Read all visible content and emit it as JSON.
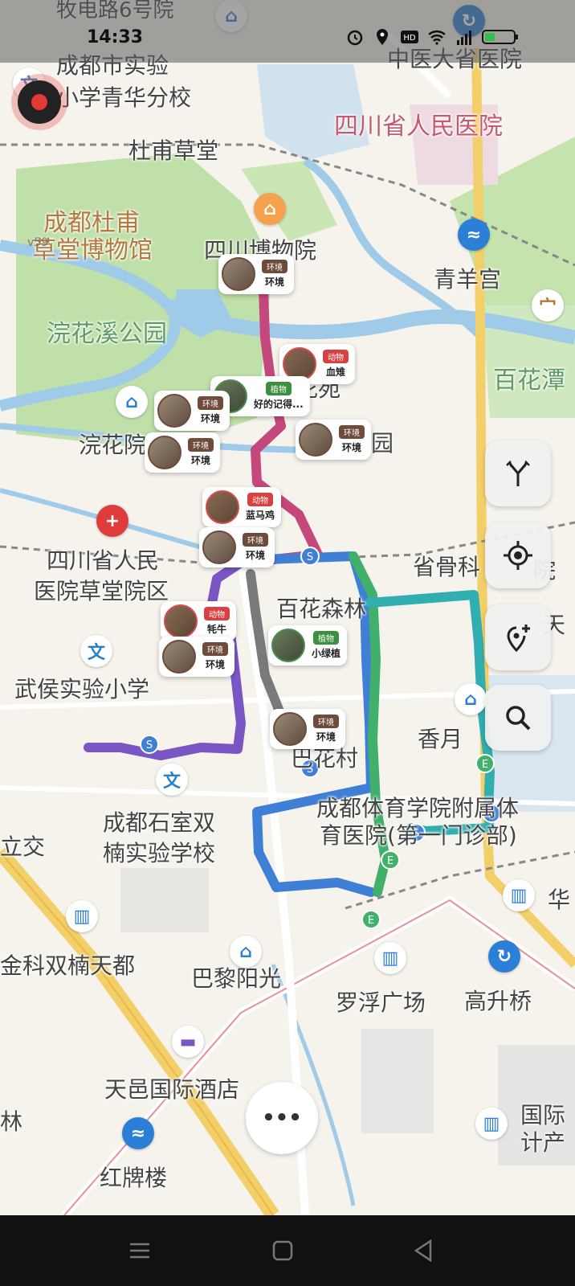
{
  "status_bar": {
    "time": "14:33"
  },
  "map": {
    "version": "v59",
    "labels": [
      {
        "text": "牧电路6号院",
        "class": "med"
      },
      {
        "text": "成都市实验",
        "class": "big"
      },
      {
        "text": "小学青华分校",
        "class": "big"
      },
      {
        "text": "中医大省医院",
        "class": "big"
      },
      {
        "text": "四川省人民医院",
        "class": "red"
      },
      {
        "text": "杜甫草堂",
        "class": "big"
      },
      {
        "text": "成都杜甫",
        "class": "brown"
      },
      {
        "text": "草堂博物馆",
        "class": "brown"
      },
      {
        "text": "四川博物院",
        "class": "big"
      },
      {
        "text": "青羊宫",
        "class": "big"
      },
      {
        "text": "浣花溪公园",
        "class": "green"
      },
      {
        "text": "百花潭",
        "class": "green"
      },
      {
        "text": "浣花院",
        "class": "big"
      },
      {
        "text": "花苑",
        "class": "big"
      },
      {
        "text": "园",
        "class": "big"
      },
      {
        "text": "四川省人民",
        "class": "big"
      },
      {
        "text": "医院草堂院区",
        "class": "big"
      },
      {
        "text": "百花森林",
        "class": "big"
      },
      {
        "text": "省骨科",
        "class": "big"
      },
      {
        "text": "院",
        "class": "big"
      },
      {
        "text": "天",
        "class": "big"
      },
      {
        "text": "武侯实验小学",
        "class": "big"
      },
      {
        "text": "香月",
        "class": "big"
      },
      {
        "text": "巴花村",
        "class": "big"
      },
      {
        "text": "成都体育学院附属体",
        "class": "big"
      },
      {
        "text": "育医院(第一门诊部)",
        "class": "big"
      },
      {
        "text": "成都石室双",
        "class": "big"
      },
      {
        "text": "楠实验学校",
        "class": "big"
      },
      {
        "text": "立交",
        "class": "big"
      },
      {
        "text": "华",
        "class": "big"
      },
      {
        "text": "金科双楠天都",
        "class": "big"
      },
      {
        "text": "巴黎阳光",
        "class": "big"
      },
      {
        "text": "罗浮广场",
        "class": "big"
      },
      {
        "text": "高升桥",
        "class": "big"
      },
      {
        "text": "天邑国际酒店",
        "class": "big"
      },
      {
        "text": "国际",
        "class": "big"
      },
      {
        "text": "计产",
        "class": "big"
      },
      {
        "text": "林",
        "class": "big"
      },
      {
        "text": "红牌楼",
        "class": "big"
      }
    ],
    "cards": [
      {
        "tag": "环境",
        "name": "环境",
        "type": "env"
      },
      {
        "tag": "动物",
        "name": "血雉",
        "type": "animal"
      },
      {
        "tag": "植物",
        "name": "好的记得...",
        "type": "plant"
      },
      {
        "tag": "环境",
        "name": "环境",
        "type": "env"
      },
      {
        "tag": "环境",
        "name": "环境",
        "type": "env"
      },
      {
        "tag": "环境",
        "name": "环境",
        "type": "env"
      },
      {
        "tag": "动物",
        "name": "蓝马鸡",
        "type": "animal"
      },
      {
        "tag": "环境",
        "name": "环境",
        "type": "env"
      },
      {
        "tag": "动物",
        "name": "牦牛",
        "type": "animal"
      },
      {
        "tag": "环境",
        "name": "环境",
        "type": "env"
      },
      {
        "tag": "植物",
        "name": "小绿植",
        "type": "plant"
      },
      {
        "tag": "环境",
        "name": "环境",
        "type": "env"
      }
    ],
    "poi_glyphs": {
      "culture": "文",
      "hospital": "+"
    },
    "route_colors": [
      "#c4487b",
      "#7a55c4",
      "#3f7fd6",
      "#41b06a",
      "#31aeb0",
      "#7a7a7a"
    ]
  },
  "controls": {
    "route_icon": "route-split-icon",
    "locate_icon": "locate-icon",
    "add_pin_icon": "add-pin-icon",
    "search_icon": "search-icon",
    "more_label": "•••"
  }
}
